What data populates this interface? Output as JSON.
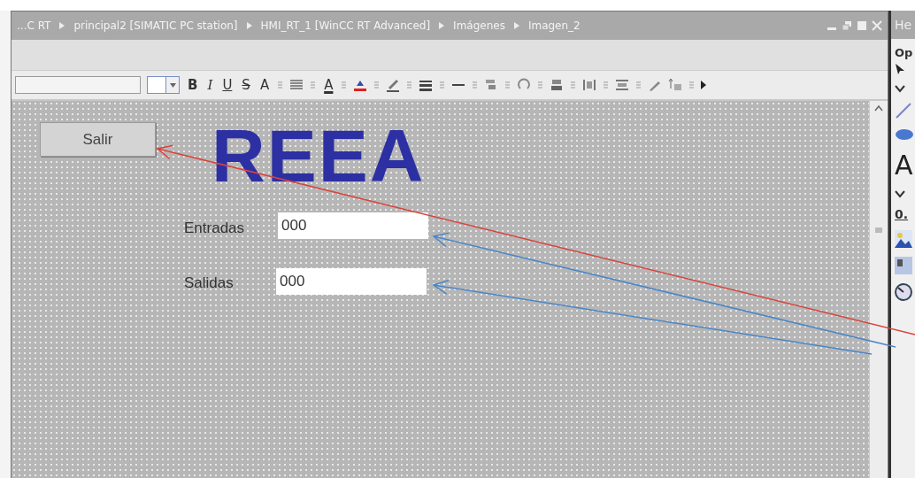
{
  "editor": {
    "breadcrumb": [
      "...C RT",
      "principal2 [SIMATIC PC station]",
      "HMI_RT_1 [WinCC RT Advanced]",
      "Imágenes",
      "Imagen_2"
    ],
    "toolbar": {
      "format_buttons": [
        "B",
        "I",
        "U",
        "S"
      ],
      "font_size_button": "A",
      "font_color_button": "A"
    },
    "screen": {
      "title": "REEA",
      "button": {
        "label": "Salir"
      },
      "fields": [
        {
          "label": "Entradas",
          "value": "000"
        },
        {
          "label": "Salidas",
          "value": "000"
        }
      ]
    }
  },
  "side_panel": {
    "title": "He",
    "section": "Op",
    "text_tool": "A",
    "item": "0."
  },
  "annotations": [
    {
      "color": "#d9443a"
    },
    {
      "color": "#4a86c8"
    },
    {
      "color": "#4a86c8"
    }
  ]
}
